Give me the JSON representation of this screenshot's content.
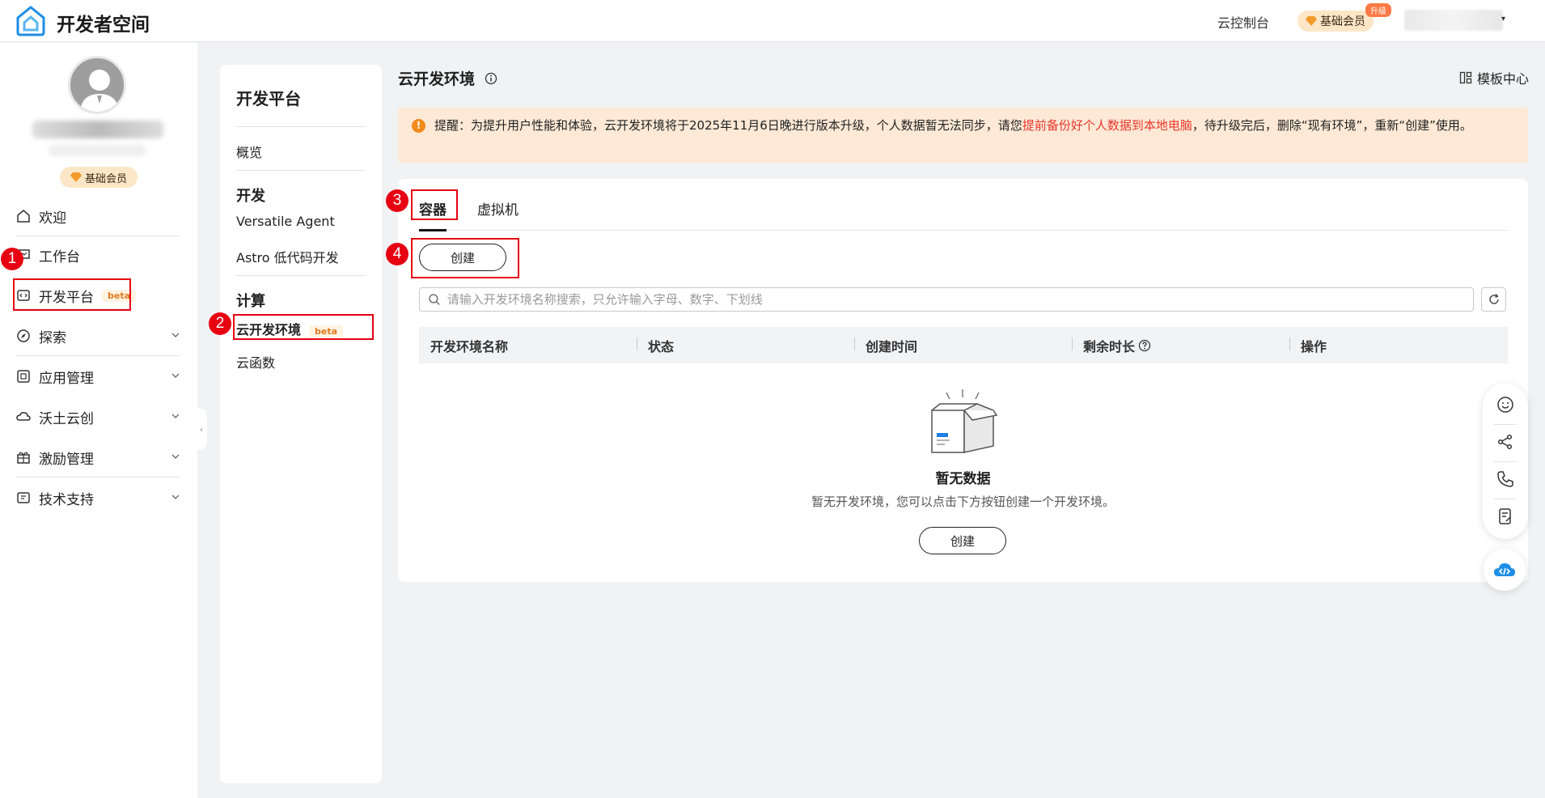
{
  "header": {
    "brand": "开发者空间",
    "console_link": "云控制台",
    "member_label": "基础会员",
    "upgrade_badge": "升级"
  },
  "sidebar": {
    "member_label": "基础会员",
    "items": [
      {
        "label": "欢迎",
        "icon": "home-icon"
      },
      {
        "label": "工作台",
        "icon": "workbench-icon"
      },
      {
        "label": "开发平台",
        "icon": "code-icon",
        "badge": "beta"
      },
      {
        "label": "探索",
        "icon": "explore-icon"
      },
      {
        "label": "应用管理",
        "icon": "app-icon"
      },
      {
        "label": "沃土云创",
        "icon": "cloud-icon"
      },
      {
        "label": "激励管理",
        "icon": "gift-icon"
      },
      {
        "label": "技术支持",
        "icon": "support-icon"
      }
    ]
  },
  "subnav": {
    "title": "开发平台",
    "overview": "概览",
    "dev_heading": "开发",
    "dev_items": [
      "Versatile Agent",
      "Astro 低代码开发"
    ],
    "compute_heading": "计算",
    "compute_items": [
      "云开发环境",
      "云函数"
    ],
    "beta": "beta"
  },
  "main": {
    "title": "云开发环境",
    "template_center": "模板中心",
    "notice": {
      "prefix": "提醒：为提升用户性能和体验，云开发环境将于2025年11月6日晚进行版本升级，个人数据暂无法同步，请您",
      "link": "提前备份好个人数据到本地电脑",
      "suffix": "，待升级完后，删除“现有环境”，重新“创建”使用。"
    },
    "tabs": [
      "容器",
      "虚拟机"
    ],
    "create_button": "创建",
    "search_placeholder": "请输入开发环境名称搜索，只允许输入字母、数字、下划线",
    "columns": [
      "开发环境名称",
      "状态",
      "创建时间",
      "剩余时长",
      "操作"
    ],
    "empty_title": "暂无数据",
    "empty_desc": "暂无开发环境，您可以点击下方按钮创建一个开发环境。",
    "empty_create_button": "创建"
  },
  "markers": [
    "1",
    "2",
    "3",
    "4"
  ],
  "colors": {
    "annotation_red": "#e60012",
    "notice_bg": "#fde9d6",
    "link_red": "#e8382c",
    "member_bg": "#fbe7c8"
  }
}
